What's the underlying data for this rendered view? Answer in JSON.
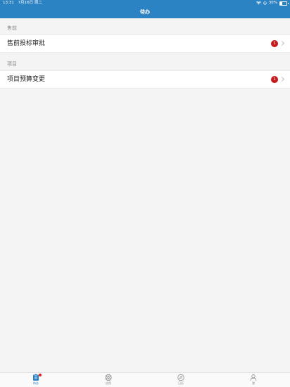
{
  "status_bar": {
    "time": "13:31",
    "date": "7月16日 周二",
    "battery": "30%"
  },
  "header": {
    "title": "待办"
  },
  "sections": [
    {
      "label": "售前",
      "item": {
        "label": "售前投标审批",
        "badge": "1"
      }
    },
    {
      "label": "项目",
      "item": {
        "label": "项目预算变更",
        "badge": "1"
      }
    }
  ],
  "tabbar": {
    "items": [
      {
        "label": "待办",
        "icon": "todo-list-icon",
        "active": true
      },
      {
        "label": "应用",
        "icon": "apps-icon",
        "active": false
      },
      {
        "label": "日历",
        "icon": "compass-icon",
        "active": false
      },
      {
        "label": "我",
        "icon": "person-icon",
        "active": false
      }
    ]
  },
  "colors": {
    "header": "#2b83c4",
    "badge": "#c8161d",
    "background": "#f4f4f5"
  }
}
